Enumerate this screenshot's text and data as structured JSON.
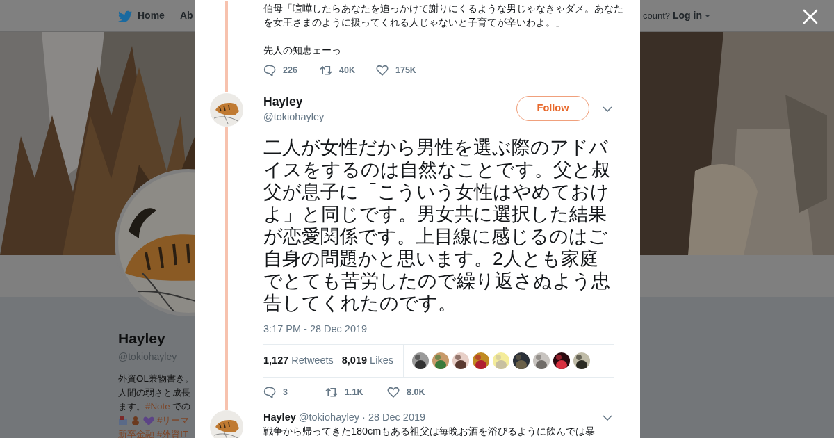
{
  "background_page": {
    "nav": {
      "items": [
        {
          "label": "Home",
          "kind": "home"
        },
        {
          "label": "Ab",
          "kind": "link"
        }
      ],
      "account_prompt": "count?",
      "login": "Log in"
    },
    "profile": {
      "name": "Hayley",
      "handle": "@tokiohayley",
      "bio_lines": [
        {
          "kind": "text",
          "segments": [
            {
              "text": "外資OL兼物書き。",
              "kind": "plain"
            }
          ]
        },
        {
          "kind": "text",
          "segments": [
            {
              "text": "人間の弱さと成長",
              "kind": "plain"
            }
          ]
        },
        {
          "kind": "text",
          "segments": [
            {
              "text": "ます。",
              "kind": "plain"
            },
            {
              "text": "#Note",
              "kind": "hashtag"
            },
            {
              "text": " での",
              "kind": "plain"
            }
          ]
        },
        {
          "kind": "emoji_line",
          "segments": [
            {
              "text": "#リーマ",
              "kind": "hashtag"
            }
          ]
        },
        {
          "kind": "text",
          "segments": [
            {
              "text": "新卒金融",
              "kind": "hashtag"
            },
            {
              "text": " #外資IT",
              "kind": "hashtag"
            }
          ]
        }
      ]
    }
  },
  "modal": {
    "previous_tweet": {
      "paragraphs": [
        "伯母「喧嘩したらあなたを追っかけて謝りにくるような男じゃなきゃダメ。あなたを女王さまのように扱ってくれる人じゃないと子育てが辛いわよ。」",
        "先人の知恵ェーっ"
      ],
      "actions": [
        {
          "kind": "reply",
          "count": "226"
        },
        {
          "kind": "retweet",
          "count": "40K"
        },
        {
          "kind": "like",
          "count": "175K"
        }
      ]
    },
    "main_tweet": {
      "name": "Hayley",
      "handle": "@tokiohayley",
      "follow_button": "Follow",
      "text": "二人が女性だから男性を選ぶ際のアドバイスをするのは自然なことです。父と叔父が息子に「こういう女性はやめておけよ」と同じです。男女共に選択した結果が恋愛関係です。上目線に感じるのはご自身の問題かと思います。2人とも家庭でとても苦労したので繰り返さぬよう忠告してくれたのです。",
      "timestamp": "3:17 PM - 28 Dec 2019",
      "stats": [
        {
          "count": "1,127",
          "label": "Retweets"
        },
        {
          "count": "8,019",
          "label": "Likes"
        }
      ],
      "actions": [
        {
          "kind": "reply",
          "count": "3"
        },
        {
          "kind": "retweet",
          "count": "1.1K"
        },
        {
          "kind": "like",
          "count": "8.0K"
        }
      ]
    },
    "reply_tweet": {
      "name": "Hayley",
      "handle": "@tokiohayley",
      "date": "· 28 Dec 2019",
      "text": "戦争から帰ってきた180cmもある祖父は毎晩お酒を浴びるように飲んでは暴"
    }
  }
}
